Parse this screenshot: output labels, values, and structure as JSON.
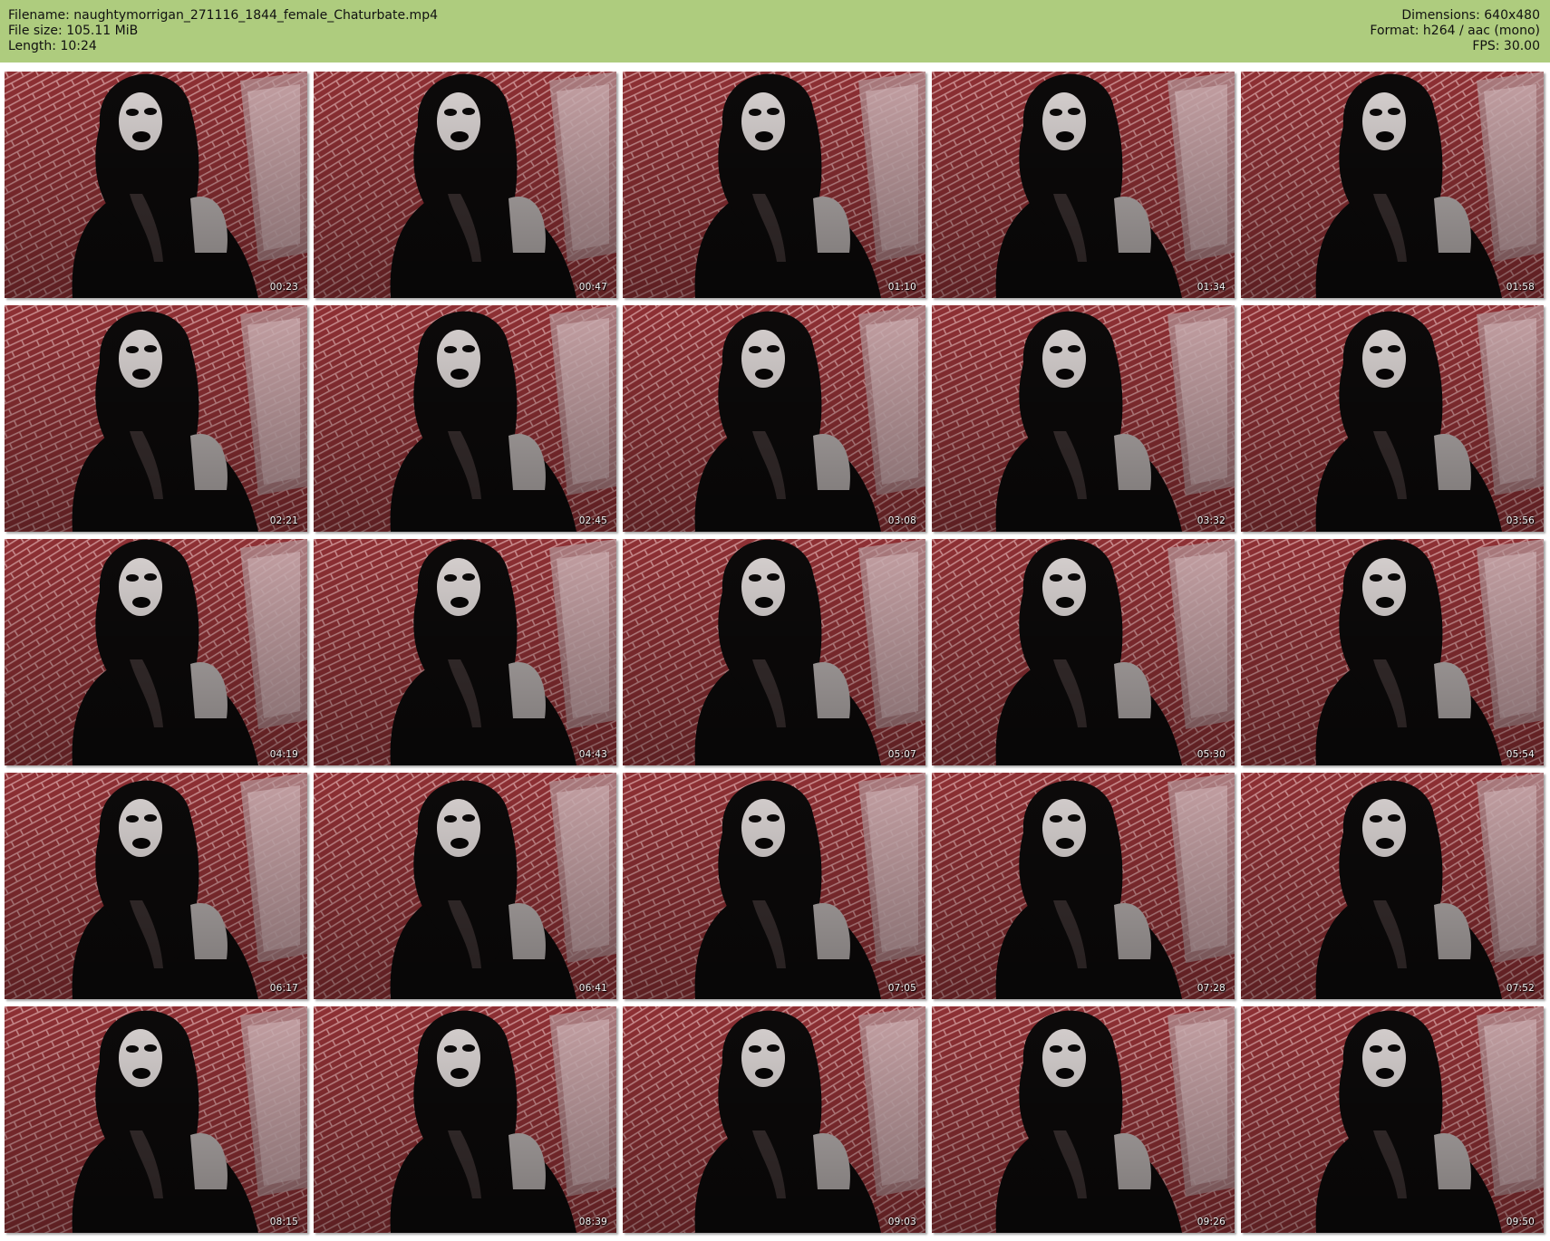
{
  "header": {
    "filename_line": "Filename: naughtymorrigan_271116_1844_female_Chaturbate.mp4",
    "filesize_line": "File size: 105.11 MiB",
    "length_line": "Length: 10:24",
    "dimensions_line": "Dimensions: 640x480",
    "format_line": "Format: h264 / aac (mono)",
    "fps_line": "FPS: 30.00"
  },
  "colors": {
    "header_bg": "#aecc7e",
    "brick": "#8e3034",
    "mortar": "#c98a8c",
    "figure": "#0c0a0a",
    "skin": "#d9d3d2"
  },
  "thumbnails": [
    {
      "time": "00:23"
    },
    {
      "time": "00:47"
    },
    {
      "time": "01:10"
    },
    {
      "time": "01:34"
    },
    {
      "time": "01:58"
    },
    {
      "time": "02:21"
    },
    {
      "time": "02:45"
    },
    {
      "time": "03:08"
    },
    {
      "time": "03:32"
    },
    {
      "time": "03:56"
    },
    {
      "time": "04:19"
    },
    {
      "time": "04:43"
    },
    {
      "time": "05:07"
    },
    {
      "time": "05:30"
    },
    {
      "time": "05:54"
    },
    {
      "time": "06:17"
    },
    {
      "time": "06:41"
    },
    {
      "time": "07:05"
    },
    {
      "time": "07:28"
    },
    {
      "time": "07:52"
    },
    {
      "time": "08:15"
    },
    {
      "time": "08:39"
    },
    {
      "time": "09:03"
    },
    {
      "time": "09:26"
    },
    {
      "time": "09:50"
    }
  ]
}
